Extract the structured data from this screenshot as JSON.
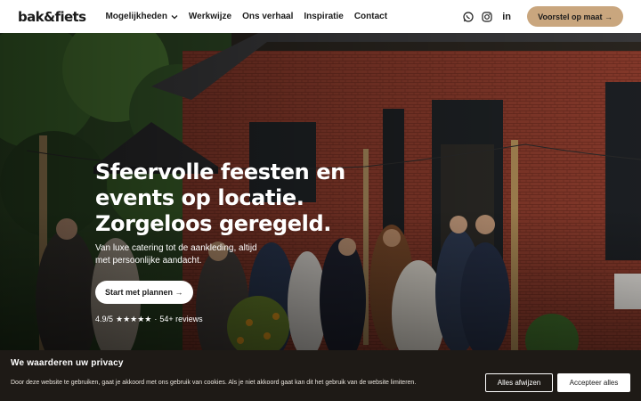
{
  "header": {
    "logo": "bak&fiets",
    "nav": [
      {
        "label": "Mogelijkheden"
      },
      {
        "label": "Werkwijze"
      },
      {
        "label": "Ons verhaal"
      },
      {
        "label": "Inspiratie"
      },
      {
        "label": "Contact"
      }
    ],
    "social_icons": [
      "whatsapp-icon",
      "instagram-icon",
      "linkedin-icon"
    ],
    "linkedin_glyph": "in",
    "cta_label": "Voorstel op maat →"
  },
  "hero": {
    "title_lines": [
      "Sfeervolle feesten en",
      "events op locatie.",
      "Zorgeloos geregeld."
    ],
    "subtitle": "Van luxe catering tot de aankleding, altijd met persoonlijke aandacht.",
    "cta_label": "Start met plannen →",
    "rating": {
      "score": "4.9/5",
      "stars": "★★★★★",
      "separator": "·",
      "reviews": "54+ reviews"
    }
  },
  "cookie": {
    "title": "We waarderen uw privacy",
    "text": "Door deze website te gebruiken, gaat je akkoord met ons gebruik van cookies. Als je niet akkoord gaat kan dit het gebruik van de website limiteren.",
    "reject_label": "Alles afwijzen",
    "accept_label": "Accepteer alles"
  },
  "colors": {
    "accent": "#c9a67e",
    "cookie_bg": "#1e1a16",
    "brick": "#8a3b2c"
  }
}
